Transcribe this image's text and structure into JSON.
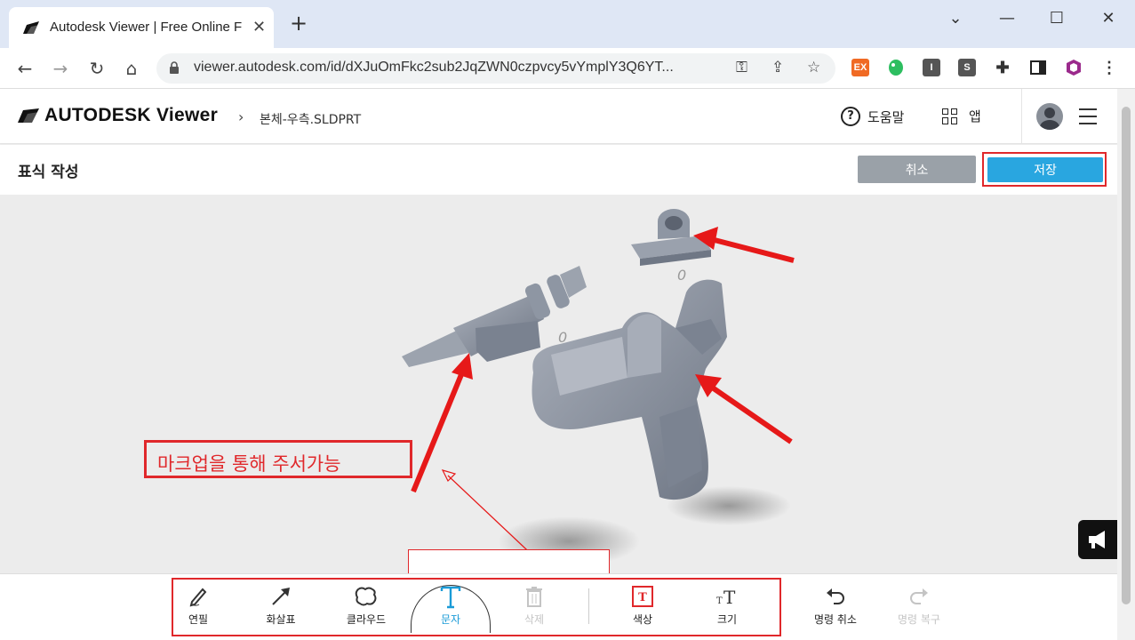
{
  "browser": {
    "tab_title": "Autodesk Viewer | Free Online F",
    "url": "viewer.autodesk.com/id/dXJuOmFkc2sub2JqZWN0czpvcy5vYmplY3Q6YT...",
    "extensions": [
      "EX",
      "I",
      "S"
    ]
  },
  "header": {
    "logo_text": "AUTODESK Viewer",
    "breadcrumb_file": "본체-우측.SLDPRT",
    "help_label": "도움말",
    "apps_label": "앱"
  },
  "markup": {
    "title": "표식 작성",
    "cancel_label": "취소",
    "save_label": "저장"
  },
  "viewport": {
    "annotation_text": "마크업을 통해 주서가능",
    "dim_label_1": "0",
    "dim_label_2": "0"
  },
  "toolbar": {
    "freehand": "연필",
    "arrow": "화살표",
    "cloud": "클라우드",
    "text": "문자",
    "delete": "삭제",
    "color": "색상",
    "size": "크기",
    "undo": "명령 취소",
    "redo": "명령 복구"
  },
  "colors": {
    "markup_red": "#e0282b",
    "accent_blue": "#29a6e0",
    "model_gray": "#8e96a3"
  }
}
